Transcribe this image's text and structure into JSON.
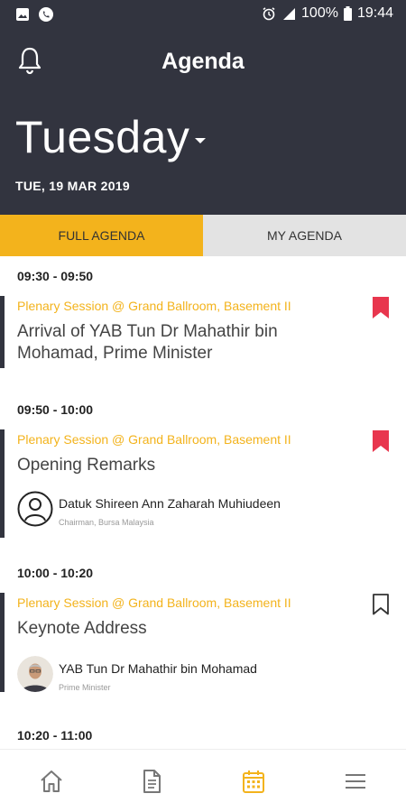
{
  "status_bar": {
    "battery": "100%",
    "time": "19:44"
  },
  "header": {
    "title": "Agenda",
    "day": "Tuesday",
    "date": "TUE, 19 MAR 2019"
  },
  "tabs": [
    {
      "label": "FULL AGENDA",
      "active": true
    },
    {
      "label": "MY AGENDA",
      "active": false
    }
  ],
  "sessions": [
    {
      "time": "09:30 - 09:50",
      "venue": "Plenary Session @ Grand Ballroom, Basement II",
      "title": "Arrival of YAB Tun Dr Mahathir bin Mohamad, Prime Minister",
      "bookmarked": true
    },
    {
      "time": "09:50 - 10:00",
      "venue": "Plenary Session @ Grand Ballroom, Basement II",
      "title": "Opening Remarks",
      "bookmarked": true,
      "speaker": {
        "name": "Datuk Shireen Ann Zaharah Muhiudeen",
        "role": "Chairman, Bursa Malaysia"
      }
    },
    {
      "time": "10:00 - 10:20",
      "venue": "Plenary Session @ Grand Ballroom, Basement II",
      "title": "Keynote Address",
      "bookmarked": false,
      "speaker": {
        "name": "YAB Tun Dr Mahathir bin Mohamad",
        "role": "Prime Minister"
      }
    },
    {
      "time": "10:20 - 11:00"
    }
  ],
  "bottom_nav": [
    "home-icon",
    "document-icon",
    "calendar-icon",
    "menu-icon"
  ],
  "colors": {
    "header_bg": "#32343f",
    "accent": "#f3b31c",
    "bookmark_active": "#e8364e"
  }
}
